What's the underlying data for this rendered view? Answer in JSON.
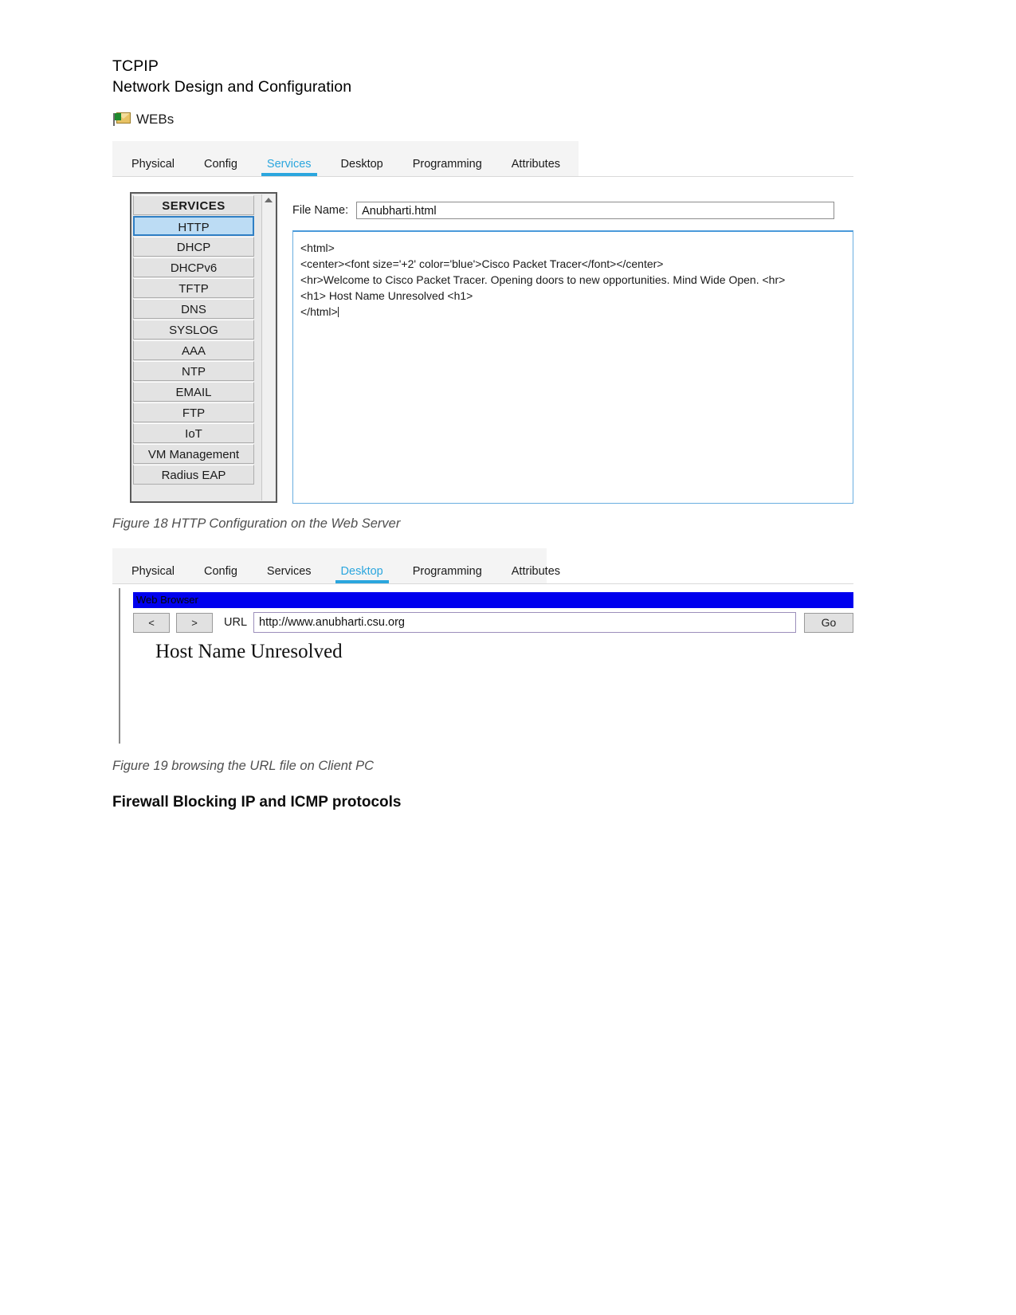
{
  "document": {
    "title_line1": "TCPIP",
    "title_line2": "Network Design and Configuration",
    "section_heading": "Firewall Blocking IP and ICMP protocols"
  },
  "device": {
    "label": "WEBs",
    "icon": "server-envelope-icon"
  },
  "figure18": {
    "caption": "Figure 18 HTTP Configuration on the Web Server",
    "tabs": [
      {
        "label": "Physical",
        "active": false
      },
      {
        "label": "Config",
        "active": false
      },
      {
        "label": "Services",
        "active": true
      },
      {
        "label": "Desktop",
        "active": false
      },
      {
        "label": "Programming",
        "active": false
      },
      {
        "label": "Attributes",
        "active": false
      }
    ],
    "services_panel": {
      "header": "SERVICES",
      "items": [
        {
          "label": "HTTP",
          "selected": true
        },
        {
          "label": "DHCP",
          "selected": false
        },
        {
          "label": "DHCPv6",
          "selected": false
        },
        {
          "label": "TFTP",
          "selected": false
        },
        {
          "label": "DNS",
          "selected": false
        },
        {
          "label": "SYSLOG",
          "selected": false
        },
        {
          "label": "AAA",
          "selected": false
        },
        {
          "label": "NTP",
          "selected": false
        },
        {
          "label": "EMAIL",
          "selected": false
        },
        {
          "label": "FTP",
          "selected": false
        },
        {
          "label": "IoT",
          "selected": false
        },
        {
          "label": "VM Management",
          "selected": false
        },
        {
          "label": "Radius EAP",
          "selected": false
        }
      ],
      "scroll_up_icon": "chevron-up-icon"
    },
    "file_name_label": "File Name:",
    "file_name_value": "Anubharti.html",
    "code_lines": [
      "<html>",
      "<center><font size='+2' color='blue'>Cisco Packet Tracer</font></center>",
      "<hr>Welcome to Cisco Packet Tracer. Opening doors to new opportunities. Mind Wide Open. <hr>",
      "<h1> Host Name Unresolved <h1>",
      "</html>"
    ]
  },
  "figure19": {
    "caption": "Figure 19 browsing the URL file on Client PC",
    "tabs": [
      {
        "label": "Physical",
        "active": false
      },
      {
        "label": "Config",
        "active": false
      },
      {
        "label": "Services",
        "active": false
      },
      {
        "label": "Desktop",
        "active": true
      },
      {
        "label": "Programming",
        "active": false
      },
      {
        "label": "Attributes",
        "active": false
      }
    ],
    "browser": {
      "window_title": "Web Browser",
      "back_label": "<",
      "forward_label": ">",
      "url_label": "URL",
      "url_value": "http://www.anubharti.csu.org",
      "go_label": "Go",
      "page_heading": "Host Name Unresolved"
    }
  },
  "colors": {
    "tab_active": "#2ba6de",
    "browser_titlebar": "#0000ee",
    "selection": "#bcdcf4"
  }
}
